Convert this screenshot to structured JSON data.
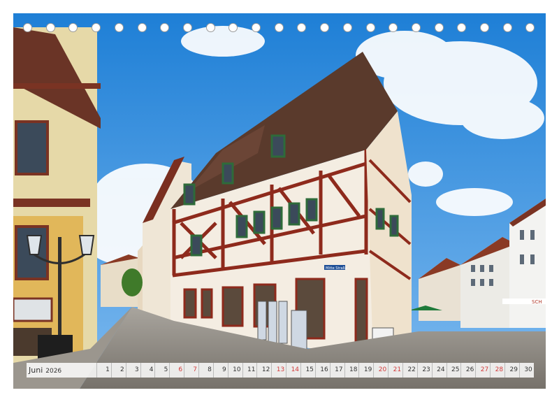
{
  "calendar": {
    "month": "Juni",
    "year": "2026",
    "days": [
      {
        "n": "1",
        "we": false
      },
      {
        "n": "2",
        "we": false
      },
      {
        "n": "3",
        "we": false
      },
      {
        "n": "4",
        "we": false
      },
      {
        "n": "5",
        "we": false
      },
      {
        "n": "6",
        "we": true
      },
      {
        "n": "7",
        "we": true
      },
      {
        "n": "8",
        "we": false
      },
      {
        "n": "9",
        "we": false
      },
      {
        "n": "10",
        "we": false
      },
      {
        "n": "11",
        "we": false
      },
      {
        "n": "12",
        "we": false
      },
      {
        "n": "13",
        "we": true
      },
      {
        "n": "14",
        "we": true
      },
      {
        "n": "15",
        "we": false
      },
      {
        "n": "16",
        "we": false
      },
      {
        "n": "17",
        "we": false
      },
      {
        "n": "18",
        "we": false
      },
      {
        "n": "19",
        "we": false
      },
      {
        "n": "20",
        "we": true
      },
      {
        "n": "21",
        "we": true
      },
      {
        "n": "22",
        "we": false
      },
      {
        "n": "23",
        "we": false
      },
      {
        "n": "24",
        "we": false
      },
      {
        "n": "25",
        "we": false
      },
      {
        "n": "26",
        "we": false
      },
      {
        "n": "27",
        "we": true
      },
      {
        "n": "28",
        "we": true
      },
      {
        "n": "29",
        "we": false
      },
      {
        "n": "30",
        "we": false
      }
    ]
  },
  "photo": {
    "sign_street": "Mitte Straße",
    "sign_shop": "SCH"
  },
  "colors": {
    "sky": "#2f8fe0",
    "timber": "#8e2a1c",
    "plaster": "#f3ece1",
    "cobble": "#8e8a84"
  }
}
